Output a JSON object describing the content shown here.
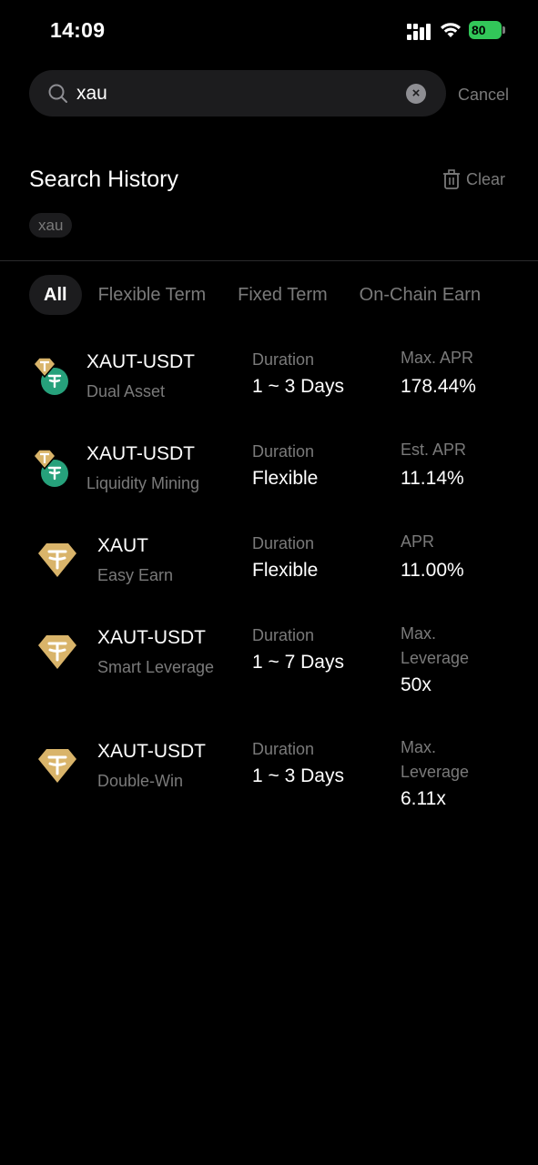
{
  "status_bar": {
    "time": "14:09",
    "battery": "80"
  },
  "search": {
    "query": "xau",
    "cancel_label": "Cancel",
    "clear_symbol": "×"
  },
  "history": {
    "title": "Search History",
    "clear_label": "Clear",
    "chips": [
      "xau"
    ]
  },
  "tabs": [
    "All",
    "Flexible Term",
    "Fixed Term",
    "On-Chain Earn"
  ],
  "results": [
    {
      "name": "XAUT-USDT",
      "product": "Dual Asset",
      "duration_label": "Duration",
      "duration": "1 ~ 3 Days",
      "rate_label": "Max. APR",
      "rate": "178.44%",
      "icon": "xaut-usdt-pair-icon"
    },
    {
      "name": "XAUT-USDT",
      "product": "Liquidity Mining",
      "duration_label": "Duration",
      "duration": "Flexible",
      "rate_label": "Est. APR",
      "rate": "11.14%",
      "icon": "xaut-usdt-pair-icon"
    },
    {
      "name": "XAUT",
      "product": "Easy Earn",
      "duration_label": "Duration",
      "duration": "Flexible",
      "rate_label": "APR",
      "rate": "11.00%",
      "icon": "xaut-gold-icon"
    },
    {
      "name": "XAUT-USDT",
      "product": "Smart Leverage",
      "duration_label": "Duration",
      "duration": "1 ~ 7 Days",
      "rate_label": "Max. Leverage",
      "rate": "50x",
      "icon": "xaut-gold-icon"
    },
    {
      "name": "XAUT-USDT",
      "product": "Double-Win",
      "duration_label": "Duration",
      "duration": "1 ~ 3 Days",
      "rate_label": "Max. Leverage",
      "rate": "6.11x",
      "icon": "xaut-gold-icon"
    }
  ],
  "colors": {
    "background": "#000000",
    "surface": "#1c1c1e",
    "muted_text": "#7a7a7a",
    "gold": "#d9b46a",
    "teal": "#26a17b",
    "battery_green": "#32c759"
  }
}
